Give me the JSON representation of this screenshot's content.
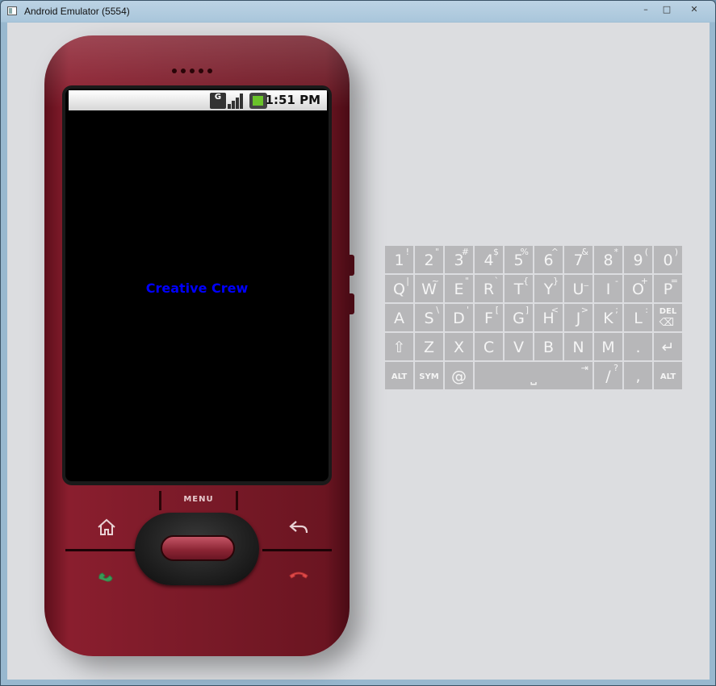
{
  "window": {
    "title": "Android Emulator (5554)",
    "controls": {
      "minimize": "–",
      "maximize": "□",
      "close": "✕"
    }
  },
  "phone": {
    "status_bar": {
      "network_badge": "G",
      "time": "1:51 PM"
    },
    "app_text": "Creative Crew",
    "app_text_color": "#0000ff",
    "menu_label": "MENU",
    "body_color": "#7a1a28"
  },
  "keyboard": {
    "rows": [
      [
        {
          "m": "1",
          "s": "!"
        },
        {
          "m": "2",
          "s": "\""
        },
        {
          "m": "3",
          "s": "#"
        },
        {
          "m": "4",
          "s": "$"
        },
        {
          "m": "5",
          "s": "%"
        },
        {
          "m": "6",
          "s": "^"
        },
        {
          "m": "7",
          "s": "&"
        },
        {
          "m": "8",
          "s": "*"
        },
        {
          "m": "9",
          "s": "("
        },
        {
          "m": "0",
          "s": ")"
        }
      ],
      [
        {
          "m": "Q",
          "s": "|"
        },
        {
          "m": "W",
          "s": "~"
        },
        {
          "m": "E",
          "s": "\""
        },
        {
          "m": "R",
          "s": "`"
        },
        {
          "m": "T",
          "s": "{"
        },
        {
          "m": "Y",
          "s": "}"
        },
        {
          "m": "U",
          "s": "_"
        },
        {
          "m": "I",
          "s": "-"
        },
        {
          "m": "O",
          "s": "+"
        },
        {
          "m": "P",
          "s": "="
        }
      ],
      [
        {
          "m": "A",
          "s": ""
        },
        {
          "m": "S",
          "s": "\\"
        },
        {
          "m": "D",
          "s": "'"
        },
        {
          "m": "F",
          "s": "["
        },
        {
          "m": "G",
          "s": "]"
        },
        {
          "m": "H",
          "s": "<"
        },
        {
          "m": "J",
          "s": ">"
        },
        {
          "m": "K",
          "s": ";"
        },
        {
          "m": "L",
          "s": ":"
        },
        {
          "m": "DEL",
          "s": "⌫"
        }
      ],
      [
        {
          "m": "⇧",
          "s": ""
        },
        {
          "m": "Z",
          "s": ""
        },
        {
          "m": "X",
          "s": ""
        },
        {
          "m": "C",
          "s": ""
        },
        {
          "m": "V",
          "s": ""
        },
        {
          "m": "B",
          "s": ""
        },
        {
          "m": "N",
          "s": ""
        },
        {
          "m": "M",
          "s": ""
        },
        {
          "m": ".",
          "s": ""
        },
        {
          "m": "↵",
          "s": ""
        }
      ],
      [
        {
          "m": "ALT",
          "s": ""
        },
        {
          "m": "SYM",
          "s": ""
        },
        {
          "m": "@",
          "s": ""
        },
        {
          "m": "⎵",
          "s": "⇥"
        },
        {
          "m": "/",
          "s": "?"
        },
        {
          "m": ",",
          "s": ""
        },
        {
          "m": "ALT",
          "s": ""
        }
      ]
    ]
  }
}
